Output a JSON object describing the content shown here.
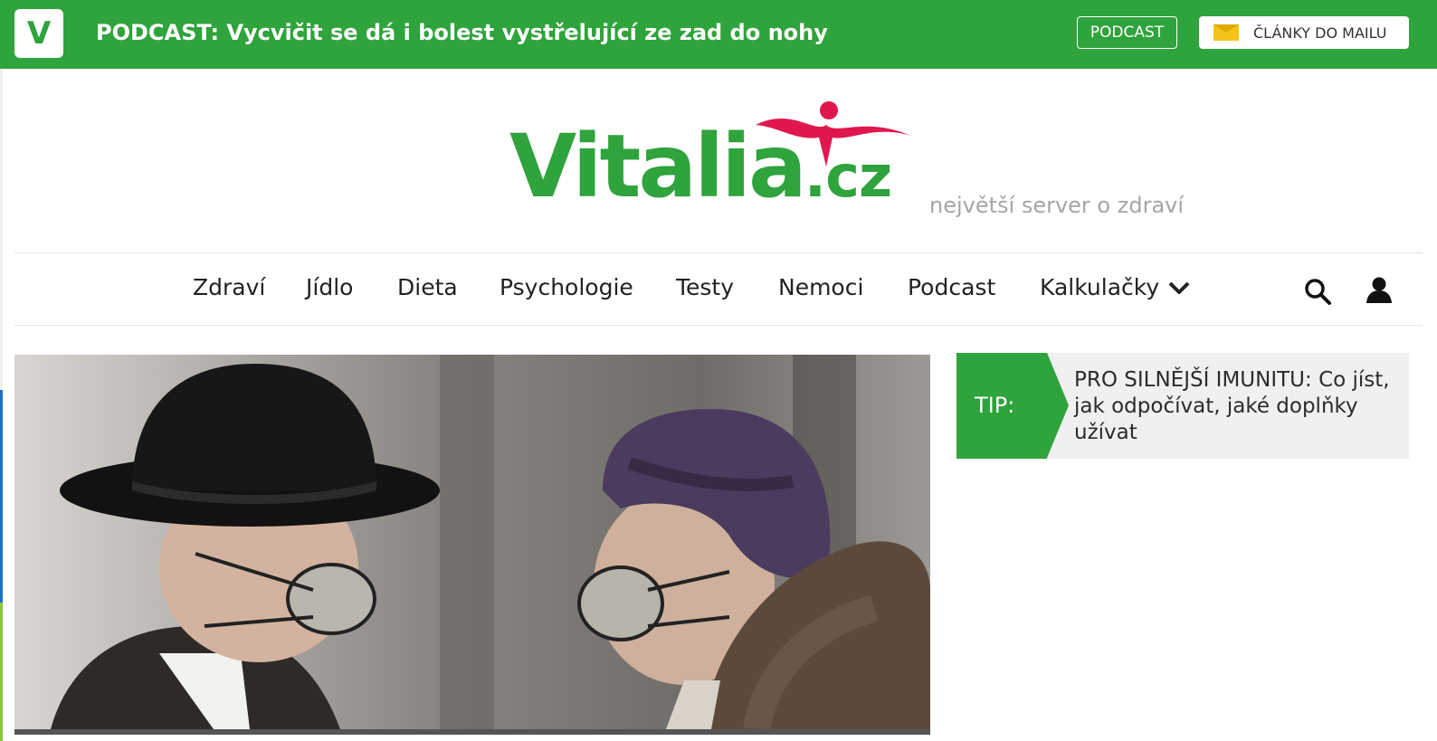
{
  "topbar": {
    "badge": "V",
    "headline": "PODCAST: Vycvičit se dá i bolest vystřelující ze zad do nohy",
    "podcast_button": "PODCAST",
    "mail_button": "ČLÁNKY DO MAILU"
  },
  "logo": {
    "word": "Vitalia",
    "domain": ".cz",
    "tagline": "největší server o zdraví"
  },
  "nav": {
    "items": [
      "Zdraví",
      "Jídlo",
      "Dieta",
      "Psychologie",
      "Testy",
      "Nemoci",
      "Podcast",
      "Kalkulačky"
    ]
  },
  "tip": {
    "label": "TIP:",
    "text": "PRO SILNĚJŠÍ IMUNITU: Co jíst, jak odpočívat, jaké doplňky užívat"
  },
  "colors": {
    "brand_green": "#2fa33c",
    "brand_red": "#e0174f"
  }
}
